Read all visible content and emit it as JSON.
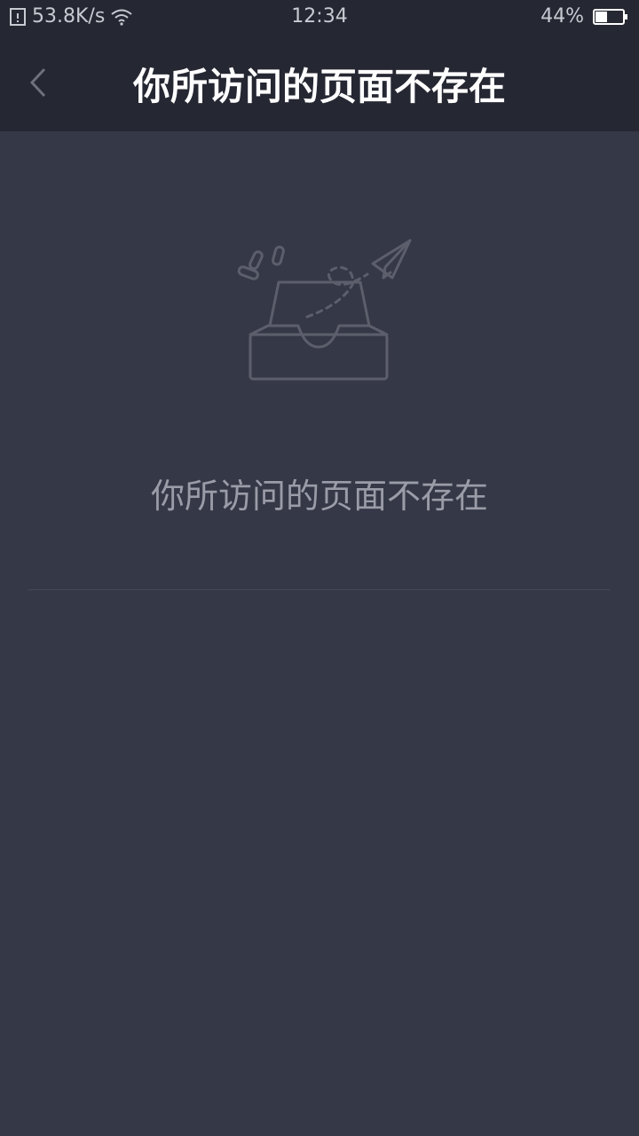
{
  "status_bar": {
    "network_speed": "53.8K/s",
    "time": "12:34",
    "battery_percent": "44%",
    "battery_level": 0.44,
    "icons": [
      "sim-icon",
      "wifi-icon",
      "battery-icon"
    ]
  },
  "app_bar": {
    "title": "你所访问的页面不存在",
    "back_icon": "chevron-left-icon"
  },
  "main": {
    "illustration_icon": "empty-inbox-paper-plane-icon",
    "message": "你所访问的页面不存在"
  },
  "colors": {
    "background": "#343847",
    "bar_background": "#252732",
    "title_text": "#ffffff",
    "message_text": "#9a9ca7",
    "icon_stroke": "#5c5f6b"
  }
}
